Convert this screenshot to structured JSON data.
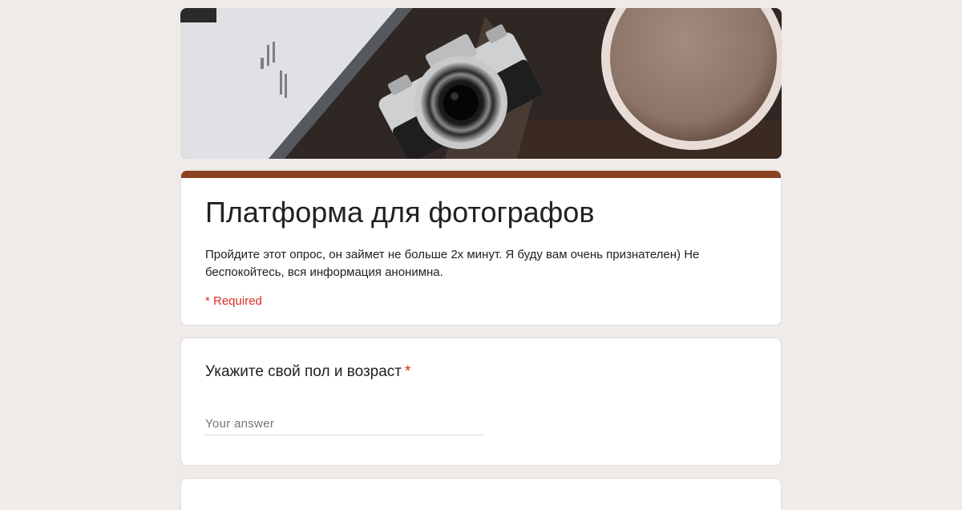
{
  "header": {
    "image_subject": "camera-laptop-coffee-photo"
  },
  "form": {
    "title": "Платформа для фотографов",
    "description": "Пройдите этот опрос, он займет не больше 2х минут. Я буду вам очень признателен) Не беспокойтесь, вся информация анонимна.",
    "required_note": "* Required",
    "theme_color": "#8a4221"
  },
  "questions": [
    {
      "title": "Укажите свой пол и возраст",
      "required_mark": "*",
      "placeholder": "Your answer",
      "value": ""
    }
  ]
}
